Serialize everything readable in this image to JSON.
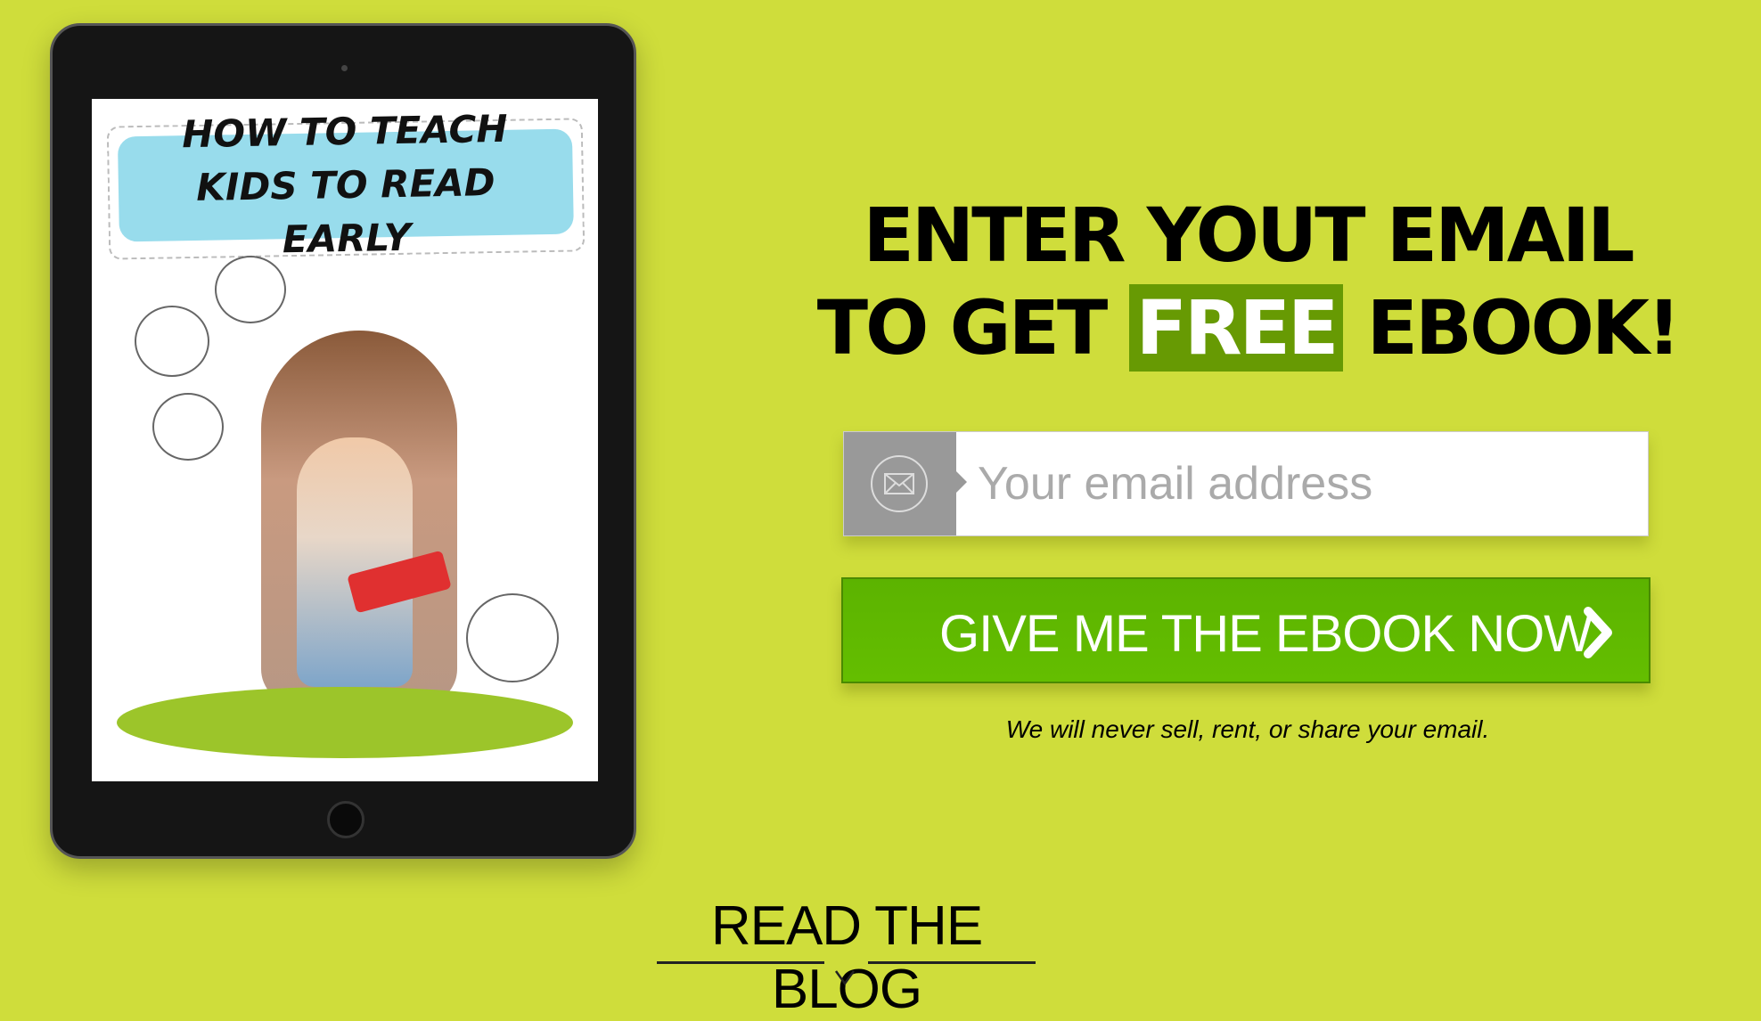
{
  "ebook": {
    "cover_title": "HOW TO TEACH KIDS TO READ EARLY"
  },
  "headline": {
    "line1": "ENTER YOUT EMAIL",
    "line2_before": "TO GET",
    "line2_highlight": "FREE",
    "line2_after": "EBOOK!"
  },
  "form": {
    "email_placeholder": "Your email address",
    "email_value": "",
    "submit_label": "GIVE ME THE EBOOK NOW",
    "disclaimer": "We will never sell, rent, or share your email."
  },
  "footer": {
    "read_blog": "READ THE BLOG"
  },
  "colors": {
    "background": "#cfdd3b",
    "highlight": "#679a03",
    "button": "#5fb800"
  }
}
